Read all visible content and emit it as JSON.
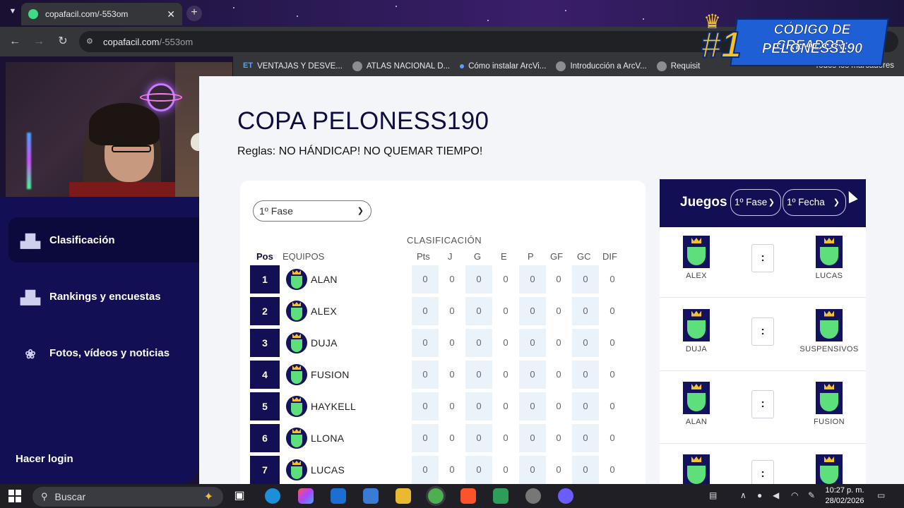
{
  "browser": {
    "tab_title": "copafacil.com/-553om",
    "url_host": "copafacil.com",
    "url_path": "/-553om",
    "bookmarks": [
      "VENTAJAS Y DESVE...",
      "ATLAS NACIONAL D...",
      "Cómo instalar ArcVi...",
      "Introducción a ArcV...",
      "Requisit"
    ],
    "bookmark_first_icon": "ET",
    "all_bookmarks": "Todos los marcadores"
  },
  "promo": {
    "rank": "#1",
    "line1": "CÓDIGO DE CREADOR:",
    "line2": "PELONESS190"
  },
  "sidebar": {
    "items": [
      {
        "label": "Clasificación",
        "icon": "podium-icon",
        "active": true
      },
      {
        "label": "Rankings y encuestas",
        "icon": "rankings-icon",
        "active": false
      },
      {
        "label": "Fotos, vídeos y noticias",
        "icon": "media-icon",
        "active": false
      }
    ],
    "login": "Hacer login"
  },
  "main": {
    "title": "COPA PELONESS190",
    "rules": "Reglas: NO HÁNDICAP! NO QUEMAR TIEMPO!",
    "phase_select": "1º Fase",
    "section_label": "CLASIFICACIÓN",
    "headers": {
      "pos": "Pos",
      "team": "EQUIPOS",
      "pts": "Pts",
      "j": "J",
      "g": "G",
      "e": "E",
      "p": "P",
      "gf": "GF",
      "gc": "GC",
      "dif": "DIF"
    },
    "rows": [
      {
        "pos": "1",
        "team": "ALAN",
        "stats": [
          "0",
          "0",
          "0",
          "0",
          "0",
          "0",
          "0",
          "0"
        ]
      },
      {
        "pos": "2",
        "team": "ALEX",
        "stats": [
          "0",
          "0",
          "0",
          "0",
          "0",
          "0",
          "0",
          "0"
        ]
      },
      {
        "pos": "3",
        "team": "DUJA",
        "stats": [
          "0",
          "0",
          "0",
          "0",
          "0",
          "0",
          "0",
          "0"
        ]
      },
      {
        "pos": "4",
        "team": "FUSION",
        "stats": [
          "0",
          "0",
          "0",
          "0",
          "0",
          "0",
          "0",
          "0"
        ]
      },
      {
        "pos": "5",
        "team": "HAYKELL",
        "stats": [
          "0",
          "0",
          "0",
          "0",
          "0",
          "0",
          "0",
          "0"
        ]
      },
      {
        "pos": "6",
        "team": "LLONA",
        "stats": [
          "0",
          "0",
          "0",
          "0",
          "0",
          "0",
          "0",
          "0"
        ]
      },
      {
        "pos": "7",
        "team": "LUCAS",
        "stats": [
          "0",
          "0",
          "0",
          "0",
          "0",
          "0",
          "0",
          "0"
        ]
      }
    ]
  },
  "games": {
    "title": "Juegos",
    "phase": "1º Fase",
    "date": "1º Fecha",
    "score_sep": ":",
    "matches": [
      {
        "home": "ALEX",
        "away": "LUCAS"
      },
      {
        "home": "DUJA",
        "away": "SUSPENSIVOS"
      },
      {
        "home": "ALAN",
        "away": "FUSION"
      }
    ]
  },
  "taskbar": {
    "search": "Buscar",
    "time": "10:27 p. m.",
    "date": "28/02/2026"
  }
}
